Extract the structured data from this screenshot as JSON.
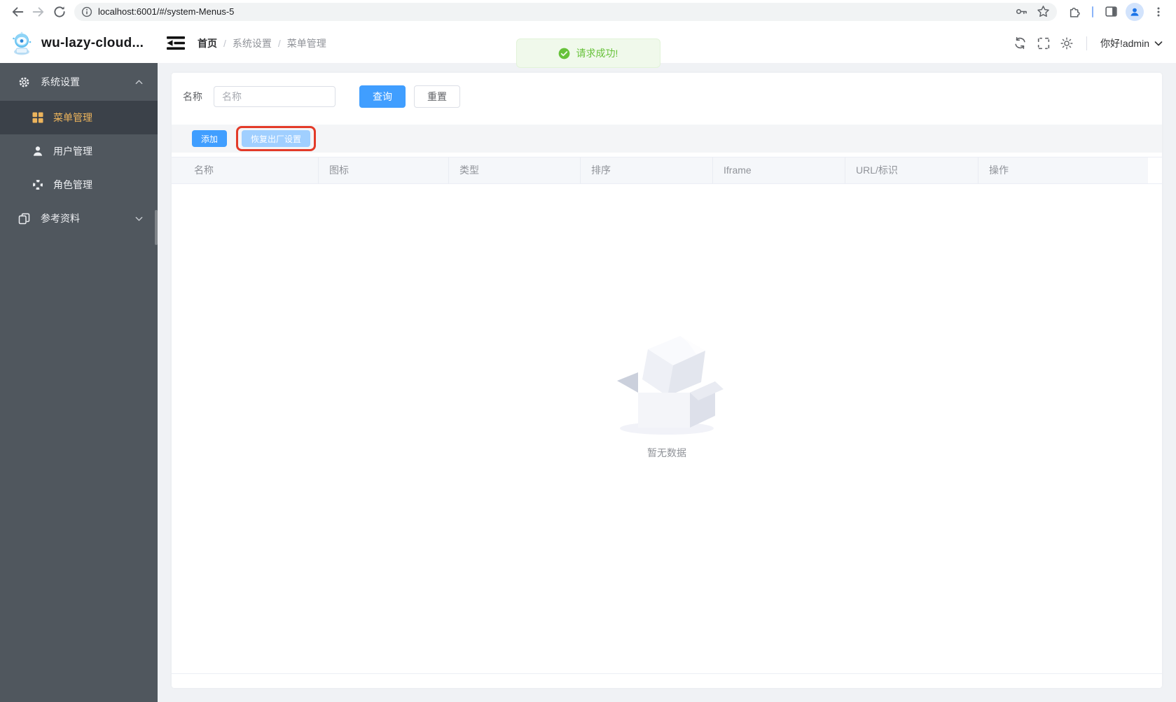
{
  "browser": {
    "url": "localhost:6001/#/system-Menus-5"
  },
  "header": {
    "app_title": "wu-lazy-cloud...",
    "breadcrumb": [
      "首页",
      "系统设置",
      "菜单管理"
    ],
    "user_greeting": "你好!admin"
  },
  "sidebar": {
    "group_system": {
      "label": "系统设置"
    },
    "items": [
      {
        "label": "菜单管理",
        "active": true
      },
      {
        "label": "用户管理",
        "active": false
      },
      {
        "label": "角色管理",
        "active": false
      }
    ],
    "group_reference": {
      "label": "参考资料"
    }
  },
  "toast": {
    "message": "请求成功!"
  },
  "filters": {
    "name_label": "名称",
    "name_placeholder": "名称",
    "name_value": "",
    "search_button": "查询",
    "reset_button": "重置"
  },
  "toolbar": {
    "add_button": "添加",
    "factory_reset_button": "恢复出厂设置"
  },
  "table": {
    "columns": [
      "名称",
      "图标",
      "类型",
      "排序",
      "Iframe",
      "URL/标识",
      "操作"
    ],
    "rows": [],
    "empty_text": "暂无数据"
  },
  "colors": {
    "primary": "#409eff",
    "primary_disabled": "#a0cfff",
    "success": "#67c23a",
    "sidebar_bg": "#50575e",
    "sidebar_active_bg": "#3b4149",
    "sidebar_active_text": "#ecb45c",
    "annotation_red": "#e33a28",
    "table_header_bg": "#f5f7fa",
    "page_bg": "#f0f2f5"
  }
}
